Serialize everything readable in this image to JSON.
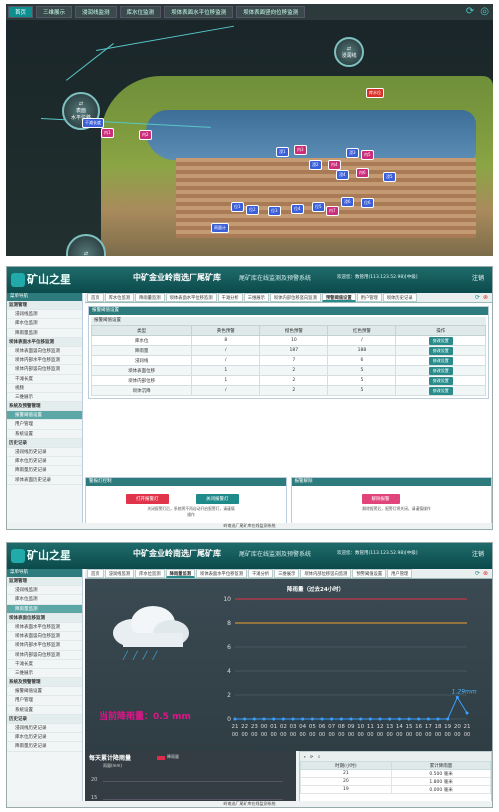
{
  "panel1": {
    "tabs": [
      "首页",
      "三维展示",
      "浸润线监测",
      "库水位监测",
      "坝体表面水平位移监测",
      "坝体表面竖向位移监测"
    ],
    "circles": [
      {
        "label": "浸润线"
      },
      {
        "label": "表面\n水平位移"
      },
      {
        "label": ""
      }
    ],
    "markers": [
      {
        "text": "库水位",
        "kind": "r"
      },
      {
        "text": "干滩长度",
        "kind": "b"
      },
      {
        "text": "内1",
        "kind": "p"
      },
      {
        "text": "内2",
        "kind": "p"
      },
      {
        "text": "浸1",
        "kind": "b"
      },
      {
        "text": "内3",
        "kind": "p"
      },
      {
        "text": "浸2",
        "kind": "b"
      },
      {
        "text": "内4",
        "kind": "p"
      },
      {
        "text": "浸3",
        "kind": "b"
      },
      {
        "text": "内5",
        "kind": "p"
      },
      {
        "text": "浸4",
        "kind": "b"
      },
      {
        "text": "内6",
        "kind": "p"
      },
      {
        "text": "浸5",
        "kind": "b"
      },
      {
        "text": "位1",
        "kind": "b"
      },
      {
        "text": "位2",
        "kind": "b"
      },
      {
        "text": "位3",
        "kind": "b"
      },
      {
        "text": "位4",
        "kind": "b"
      },
      {
        "text": "位5",
        "kind": "b"
      },
      {
        "text": "内7",
        "kind": "p"
      },
      {
        "text": "浸6",
        "kind": "b"
      },
      {
        "text": "位6",
        "kind": "b"
      },
      {
        "text": "雨量计",
        "kind": "b"
      }
    ]
  },
  "header": {
    "logo": "矿山之星",
    "title": "中矿金业岭南选厂尾矿库",
    "subtitle": "尾矿库在线监测及预警系统",
    "user": "欢迎您：数管用(113.123.52.98)[中级]",
    "exit": "注销"
  },
  "sidebar": {
    "heading": "菜单导航",
    "items_p2": [
      {
        "t": "监测管理",
        "g": true
      },
      {
        "t": "浸润线监测"
      },
      {
        "t": "库水位监测"
      },
      {
        "t": "降雨量监测"
      },
      {
        "t": "坝体表面水平位移监测",
        "g": true
      },
      {
        "t": "坝体表面竖向位移监测"
      },
      {
        "t": "坝体内部水平位移监测"
      },
      {
        "t": "坝体内部竖向位移监测"
      },
      {
        "t": "干滩长度"
      },
      {
        "t": "视频"
      },
      {
        "t": "三维展示"
      },
      {
        "t": "系统及预警管理",
        "g": true
      },
      {
        "t": "报警阈值设置",
        "sel": true
      },
      {
        "t": "用户管理"
      },
      {
        "t": "系统设置"
      },
      {
        "t": "历史记录",
        "g": true
      },
      {
        "t": "浸润线历史记录"
      },
      {
        "t": "库水位历史记录"
      },
      {
        "t": "降雨量历史记录"
      },
      {
        "t": "坝体表面历史记录"
      }
    ],
    "items_p3": [
      {
        "t": "监测管理",
        "g": true
      },
      {
        "t": "浸润线监测"
      },
      {
        "t": "库水位监测"
      },
      {
        "t": "降雨量监测",
        "sel": true
      },
      {
        "t": "坝体表面位移监测",
        "g": true
      },
      {
        "t": "坝体表面水平位移监测"
      },
      {
        "t": "坝体表面竖向位移监测"
      },
      {
        "t": "坝体内部水平位移监测"
      },
      {
        "t": "坝体内部竖向位移监测"
      },
      {
        "t": "干滩长度"
      },
      {
        "t": "三维展示"
      },
      {
        "t": "系统及预警管理",
        "g": true
      },
      {
        "t": "报警阈值设置"
      },
      {
        "t": "用户管理"
      },
      {
        "t": "系统设置"
      },
      {
        "t": "历史记录",
        "g": true
      },
      {
        "t": "浸润线历史记录"
      },
      {
        "t": "库水位历史记录"
      },
      {
        "t": "降雨量历史记录"
      }
    ]
  },
  "panel2": {
    "tabs": [
      "首页",
      "库水位监测",
      "降雨量监测",
      "坝体表面水平位移监测",
      "干滩分析",
      "三维展示",
      "坝体内部位移竖向监测",
      "预警阈值设置",
      "用户管理",
      "坝体历史记录"
    ],
    "section1": "报警阈值设置",
    "table_title": "报警阈值设置",
    "columns": [
      "类型",
      "黄色预警",
      "橙色预警",
      "红色预警",
      "操作"
    ],
    "rows": [
      [
        "库水位",
        "8",
        "10",
        "/",
        "修改设置"
      ],
      [
        "降雨量",
        "/",
        "187",
        "188",
        "修改设置"
      ],
      [
        "浸润线",
        "/",
        "7",
        "6",
        "修改设置"
      ],
      [
        "坝体表面位移",
        "1",
        "2",
        "5",
        "修改设置"
      ],
      [
        "坝体内部位移",
        "1",
        "2",
        "5",
        "修改设置"
      ],
      [
        "坝体沉降",
        "/",
        "2",
        "5",
        "修改设置"
      ]
    ],
    "section2": "警报灯控制",
    "ctrl_left_title": "警报灯控制",
    "ctrl_right_title": "报警解除",
    "btn_open": "打开报警灯",
    "btn_close": "关闭报警灯",
    "btn_release": "解除报警",
    "desc_left": "关闭报警灯后，系统将不再自动开启报警灯，请谨慎操作",
    "desc_right": "解除报警后，报警灯将关闭，请谨慎操作",
    "footer": "岭南选厂尾矿库在线监测系统"
  },
  "panel3": {
    "tabs": [
      "首页",
      "浸润线监测",
      "库水位监测",
      "降雨量监测",
      "坝体表面水平位移监测",
      "干滩分析",
      "三维展示",
      "坝体内部位移竖向监测",
      "预警阈值设置",
      "用户管理"
    ],
    "active_tab": 3,
    "chart_title": "降雨量（过去24小时）",
    "current_label": "当前降雨量：0.5 mm",
    "bottom_title": "每天累计降雨量",
    "bottom_sub": "雨量(mm)",
    "legend": "降雨量",
    "table_columns": [
      "时期(小时)",
      "累计降雨量"
    ],
    "table_rows": [
      [
        "21",
        "0.500 毫米"
      ],
      [
        "20",
        "1.800 毫米"
      ],
      [
        "19",
        "0.000 毫米"
      ]
    ],
    "y_ticks_bottom": [
      "20",
      "15"
    ],
    "footer": "岭南选厂尾矿库在线监测系统"
  },
  "chart_data": {
    "type": "line",
    "title": "降雨量（过去24小时）",
    "ylim": [
      0,
      10
    ],
    "y_ticks": [
      0,
      2,
      4,
      6,
      8,
      10
    ],
    "x": [
      "21",
      "22",
      "23",
      "00",
      "01",
      "02",
      "03",
      "04",
      "05",
      "06",
      "07",
      "08",
      "09",
      "10",
      "11",
      "12",
      "13",
      "14",
      "15",
      "16",
      "17",
      "18",
      "19",
      "20",
      "21"
    ],
    "series": [
      {
        "name": "",
        "values": [
          0,
          0,
          0,
          0,
          0,
          0,
          0,
          0,
          0,
          0,
          0,
          0,
          0,
          0,
          0,
          0,
          0,
          0,
          0,
          0,
          0,
          0,
          0,
          1.8,
          0.5
        ]
      }
    ],
    "threshold_lines": [
      {
        "value": 10,
        "color": "#e0344a"
      },
      {
        "value": 8,
        "color": "#f0a030"
      }
    ],
    "point_label": "1.29mm",
    "grid": true
  }
}
